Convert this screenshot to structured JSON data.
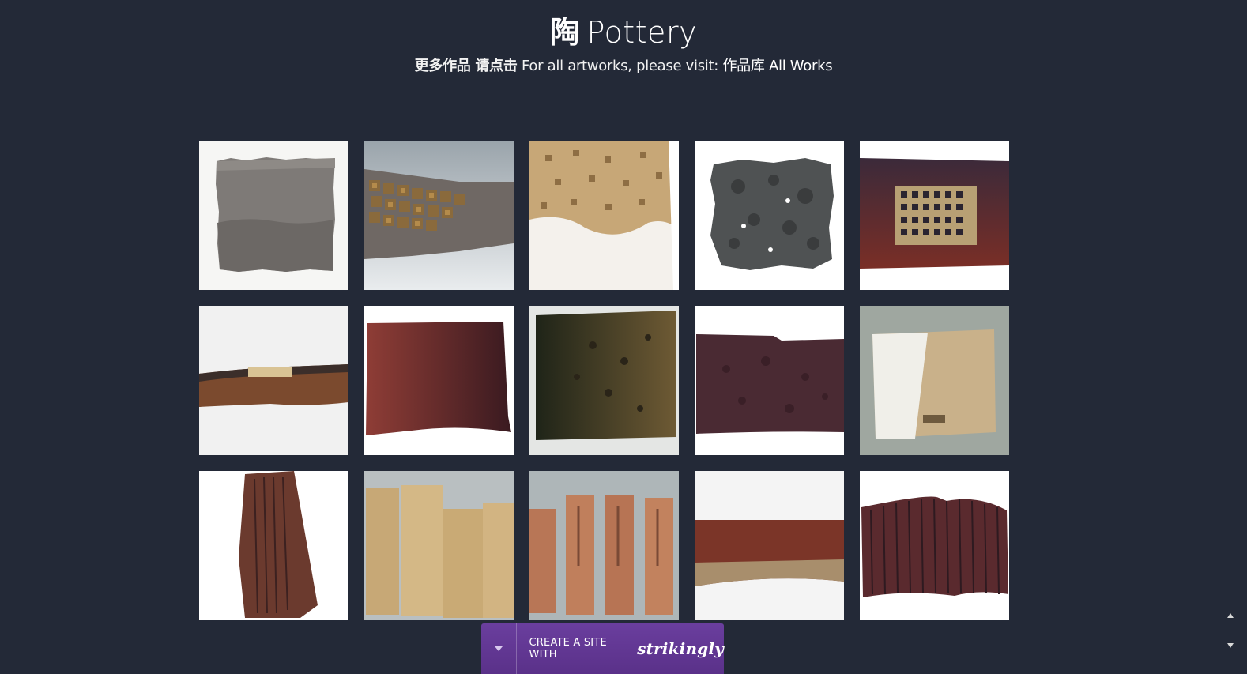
{
  "header": {
    "title_cn": "陶",
    "title_en": "Pottery"
  },
  "subtitle": {
    "cn_label": "更多作品 请点击",
    "en_label": "For all artworks, please visit:",
    "link_text": "作品库 All Works"
  },
  "gallery": {
    "items": [
      {
        "subject": "grey clay slab with torn edges"
      },
      {
        "subject": "grey slab with square tile relief"
      },
      {
        "subject": "tan slab with stamped pattern and white glaze"
      },
      {
        "subject": "dark grey pitted square slab"
      },
      {
        "subject": "dark red slab with stamped grid panel"
      },
      {
        "subject": "thin brown strip with inscription"
      },
      {
        "subject": "maroon curved slab"
      },
      {
        "subject": "dark green and brown pitted slab"
      },
      {
        "subject": "dark purple pitted slab"
      },
      {
        "subject": "white and beige box form"
      },
      {
        "subject": "tall dark textured vessel"
      },
      {
        "subject": "beige slab vessels"
      },
      {
        "subject": "four terracotta vessels"
      },
      {
        "subject": "red and tan curved band"
      },
      {
        "subject": "dark ribbed wavy form"
      }
    ]
  },
  "footer_bar": {
    "label": "CREATE A SITE WITH",
    "brand": "strikingly",
    "toggle_icon": "chevron-down-icon",
    "colors": {
      "bar": "#5e3490"
    }
  },
  "scroll_controls": {
    "up_icon": "arrow-up-icon",
    "down_icon": "arrow-down-icon"
  },
  "colors": {
    "background": "#232937",
    "text": "#ffffff"
  }
}
